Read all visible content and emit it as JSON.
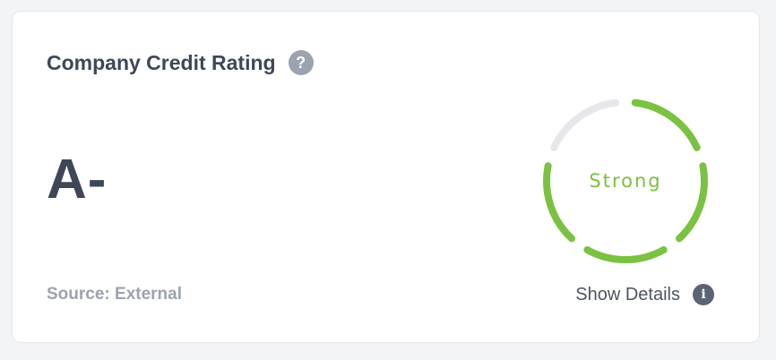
{
  "card": {
    "title": "Company Credit Rating",
    "help_icon": "question-mark-icon",
    "help_glyph": "?",
    "rating": "A-",
    "source": "Source: External",
    "gauge": {
      "label": "Strong",
      "level": 0.8,
      "fill_color": "#7bc142",
      "track_color": "#e5e7eb"
    },
    "details_label": "Show Details",
    "info_icon": "info-icon",
    "info_glyph": "i"
  }
}
